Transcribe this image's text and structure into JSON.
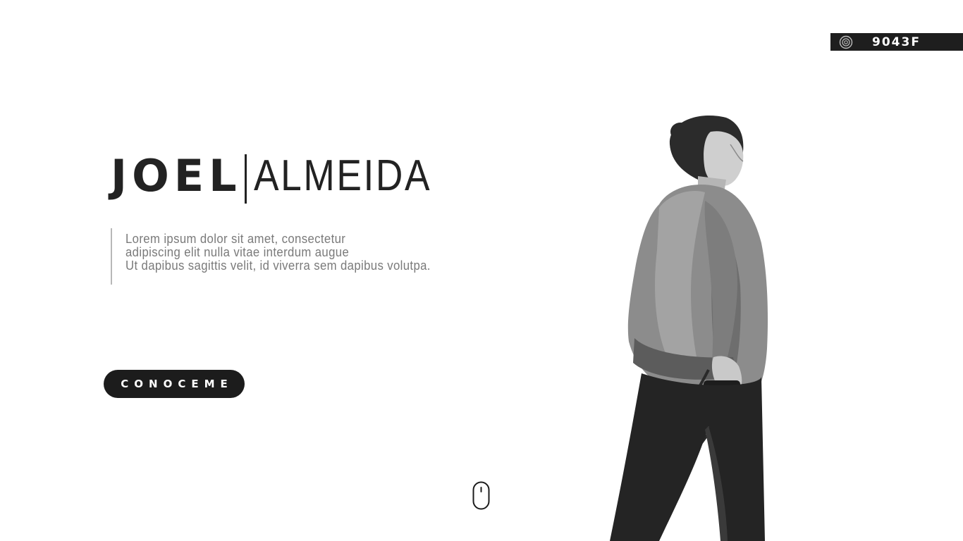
{
  "badge": {
    "icon": "instagram-icon",
    "code": "9043F"
  },
  "hero": {
    "first_name": "JOEL",
    "last_name": "ALMEIDA",
    "description_lines": [
      "Lorem ipsum dolor sit amet, consectetur",
      "adipiscing elit nulla vitae interdum augue",
      "Ut dapibus sagittis velit, id viverra sem dapibus volutpa."
    ],
    "cta_label": "CONOCEME"
  },
  "scroll_indicator": {
    "icon": "mouse-scroll-icon"
  },
  "photo": {
    "subject": "photographer-figure"
  },
  "colors": {
    "dark": "#1c1c1c",
    "text_gray": "#7a7a7a",
    "divider": "#b8b8b8",
    "background": "#ffffff"
  }
}
